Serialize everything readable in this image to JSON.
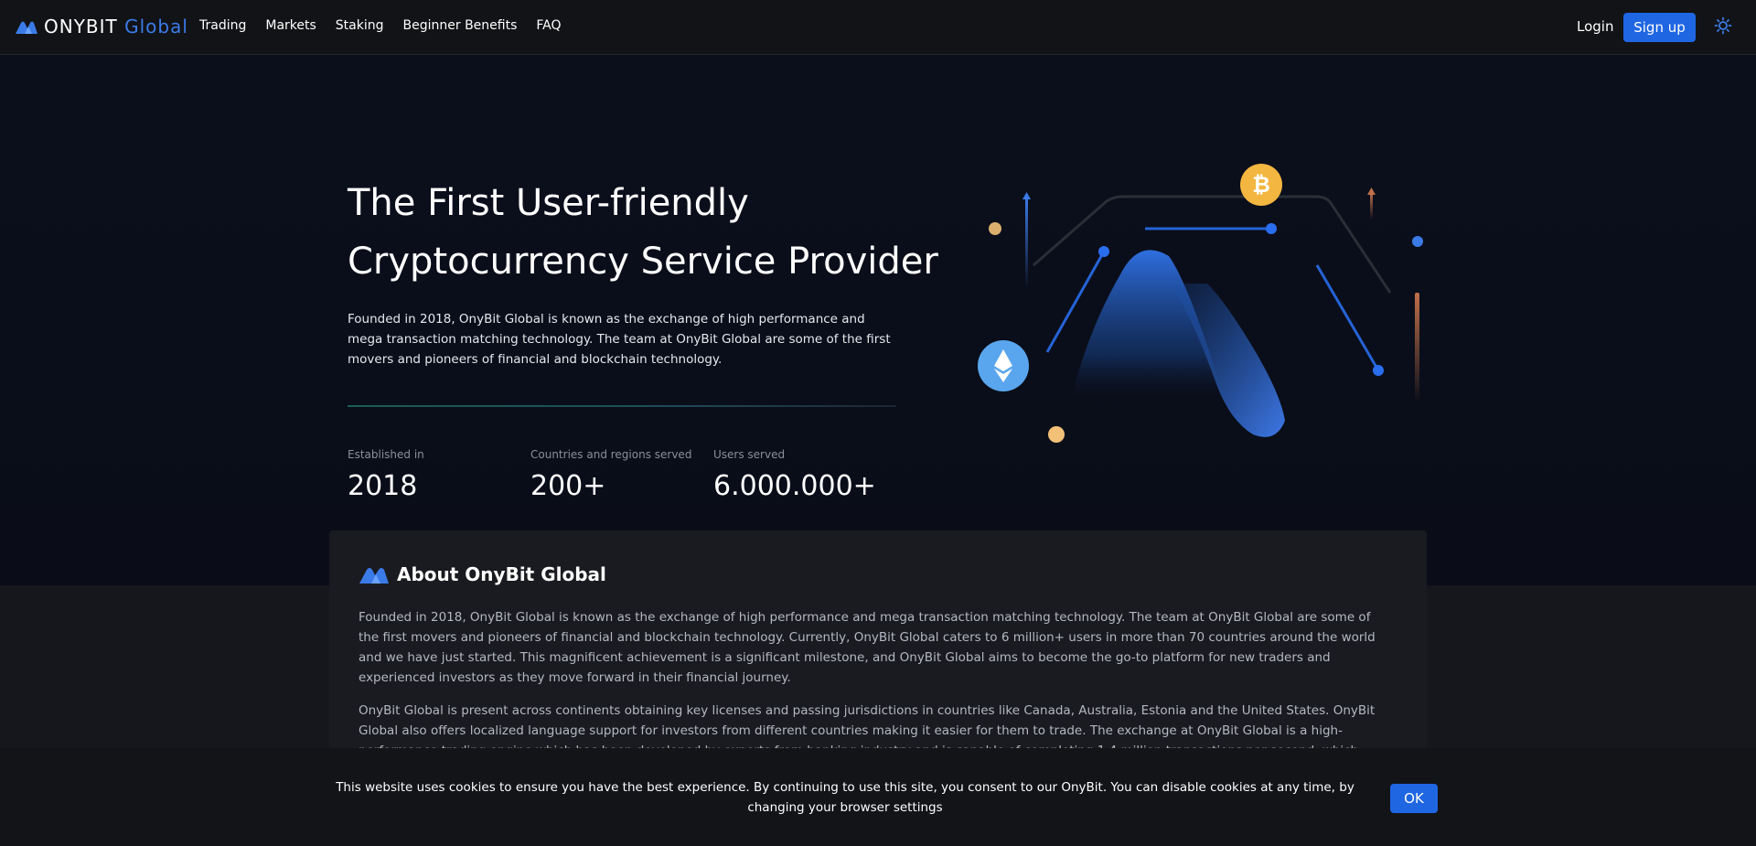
{
  "header": {
    "logo": {
      "word1": "ONYBIT",
      "word2": "Global"
    },
    "nav": [
      "Trading",
      "Markets",
      "Staking",
      "Beginner Benefits",
      "FAQ"
    ],
    "login_label": "Login",
    "signup_label": "Sign up",
    "theme_icon": "sun-icon"
  },
  "hero": {
    "title_line1": "The First User-friendly",
    "title_line2": "Cryptocurrency Service Provider",
    "description": "Founded in 2018, OnyBit Global is known as the exchange of high performance and mega transaction matching technology. The team at OnyBit Global are some of the first movers and pioneers of financial and blockchain technology.",
    "stats": [
      {
        "label": "Established in",
        "value": "2018"
      },
      {
        "label": "Countries and regions served",
        "value": "200+"
      },
      {
        "label": "Users served",
        "value": "6.000.000+"
      }
    ],
    "illustration_icons": [
      "bitcoin-icon",
      "ethereum-icon"
    ]
  },
  "about": {
    "title": "About OnyBit Global",
    "paragraphs": [
      "Founded in 2018, OnyBit Global is known as the exchange of high performance and mega transaction matching technology. The team at OnyBit Global are some of the first movers and pioneers of financial and blockchain technology. Currently, OnyBit Global caters to 6 million+ users in more than 70 countries around the world and we have just started. This magnificent achievement is a significant milestone, and OnyBit Global aims to become the go-to platform for new traders and experienced investors as they move forward in their financial journey.",
      "OnyBit Global is present across continents obtaining key licenses and passing jurisdictions in countries like Canada, Australia, Estonia and the United States. OnyBit Global also offers localized language support for investors from different countries making it easier for them to trade. The exchange at OnyBit Global is a high-performance trading engine which has been developed by experts from banking industry and is capable of completing 1.4 million transactions per second, which results in ground breaking efficiency and enhanced performance. User security if of top priority at OnyBit Global because of which our servers are hosted independently across multiple countries ensuring optimal data integrity and security."
    ]
  },
  "cookie": {
    "text": "This website uses cookies to ensure you have the best experience. By continuing to use this site, you consent to our OnyBit. You can disable cookies at any time, by changing your browser settings",
    "ok_label": "OK"
  },
  "colors": {
    "accent": "#1f66e3",
    "brand_blue": "#3b7be8",
    "bitcoin": "#f3b640"
  }
}
